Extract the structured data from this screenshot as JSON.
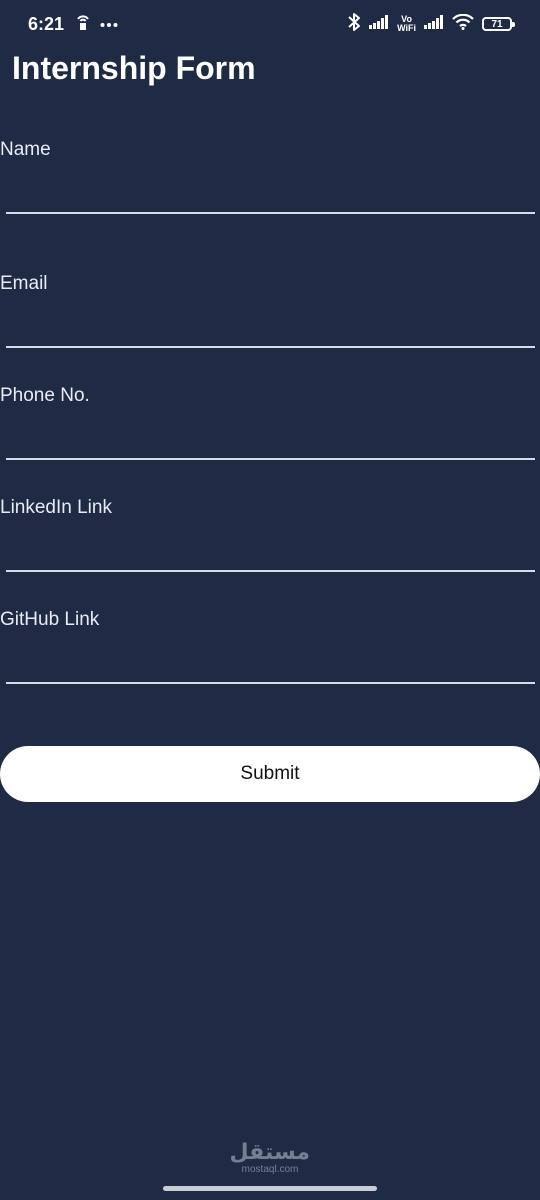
{
  "status_bar": {
    "time": "6:21",
    "left_icons": [
      "hotspot-icon",
      "more-dots-icon"
    ],
    "right_icons": [
      "bluetooth-icon",
      "signal-icon",
      "vowifi-icon",
      "signal-icon",
      "wifi-icon",
      "battery-icon"
    ],
    "vowifi_top": "Vo",
    "vowifi_bottom": "WiFi",
    "battery_level": "71"
  },
  "page": {
    "title": "Internship Form"
  },
  "form": {
    "fields": [
      {
        "label": "Name",
        "value": "",
        "placeholder": ""
      },
      {
        "label": "Email",
        "value": "",
        "placeholder": ""
      },
      {
        "label": "Phone No.",
        "value": "",
        "placeholder": ""
      },
      {
        "label": "LinkedIn Link",
        "value": "",
        "placeholder": ""
      },
      {
        "label": "GitHub Link",
        "value": "",
        "placeholder": ""
      }
    ],
    "submit_label": "Submit"
  },
  "watermark": {
    "logo": "مستقل",
    "url": "mostaql.com"
  },
  "colors": {
    "background": "#1f2a44",
    "text": "#ffffff",
    "button_background": "#ffffff",
    "button_text": "#111111"
  }
}
